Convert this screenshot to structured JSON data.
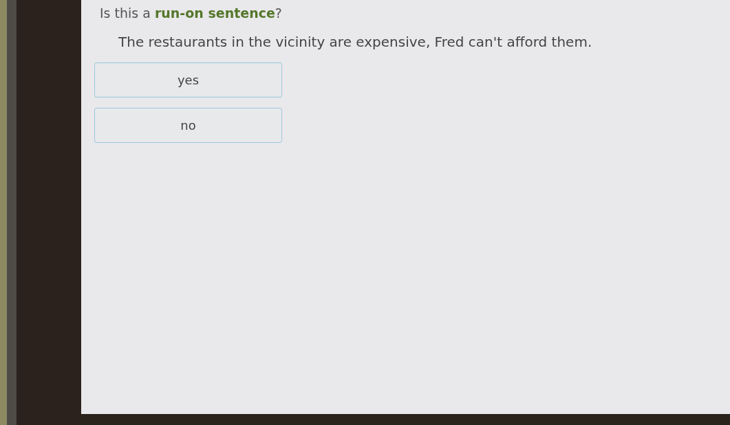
{
  "question": {
    "prompt": "Is this a **run-on sentence**?",
    "sentence": "The restaurants in the vicinity are expensive, Fred can't afford them."
  },
  "choices": [
    {
      "label": "yes",
      "selected": false
    },
    {
      "label": "no",
      "selected": false
    }
  ]
}
